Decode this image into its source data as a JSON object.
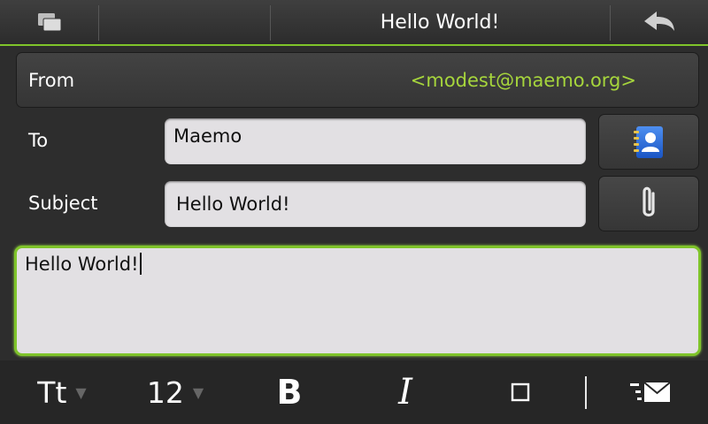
{
  "titlebar": {
    "title": "Hello World!",
    "windows_icon": "task-switcher-icon",
    "back_icon": "back-arrow-icon"
  },
  "compose": {
    "from": {
      "label": "From",
      "value": "<modest@maemo.org>"
    },
    "to": {
      "label": "To",
      "value": "Maemo",
      "button_icon": "contacts-icon"
    },
    "subject": {
      "label": "Subject",
      "value": "Hello World!",
      "button_icon": "paperclip-icon"
    },
    "body": {
      "text": "Hello World!"
    }
  },
  "toolbar": {
    "font_label": "Tt",
    "font_size": "12",
    "bold_label": "B",
    "italic_label": "I",
    "dropdown_arrow": "▼",
    "format_icon": "square-icon",
    "send_icon": "send-mail-icon"
  },
  "colors": {
    "accent": "#7fc42a",
    "from_value": "#a6d53c",
    "field_bg": "#e2e0e3"
  }
}
